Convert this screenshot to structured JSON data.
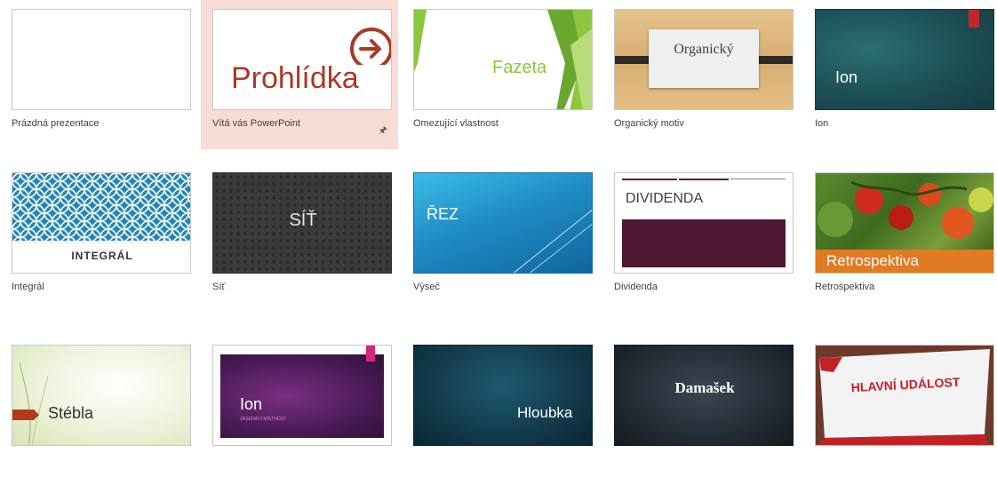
{
  "templates": [
    {
      "label": "Prázdná prezentace",
      "preview_text": ""
    },
    {
      "label": "Vítá vás PowerPoint",
      "preview_text": "Prohlídka",
      "selected": true,
      "pinned": true
    },
    {
      "label": "Omezující vlastnost",
      "preview_text": "Fazeta"
    },
    {
      "label": "Organický motiv",
      "preview_text": "Organický"
    },
    {
      "label": "Ion",
      "preview_text": "Ion"
    },
    {
      "label": "Integrál",
      "preview_text": "INTEGRÁL"
    },
    {
      "label": "Síť",
      "preview_text": "SÍŤ"
    },
    {
      "label": "Výseč",
      "preview_text": "ŘEZ"
    },
    {
      "label": "Dividenda",
      "preview_text": "DIVIDENDA"
    },
    {
      "label": "Retrospektiva",
      "preview_text": "Retrospektiva"
    },
    {
      "label": "",
      "preview_text": "Stébla"
    },
    {
      "label": "",
      "preview_text": "Ion",
      "preview_subtext": "ZASEDACÍ MÍSTNOST"
    },
    {
      "label": "",
      "preview_text": "Hloubka"
    },
    {
      "label": "",
      "preview_text": "Damašek"
    },
    {
      "label": "",
      "preview_text": "HLAVNÍ UDÁLOST"
    }
  ],
  "icons": {
    "pin": "pin-icon",
    "arrow": "arrow-right-circle-icon"
  },
  "colors": {
    "selected_bg": "#f8dcd6",
    "accent_red": "#a93a26",
    "fazeta_green": "#8dc63f"
  }
}
